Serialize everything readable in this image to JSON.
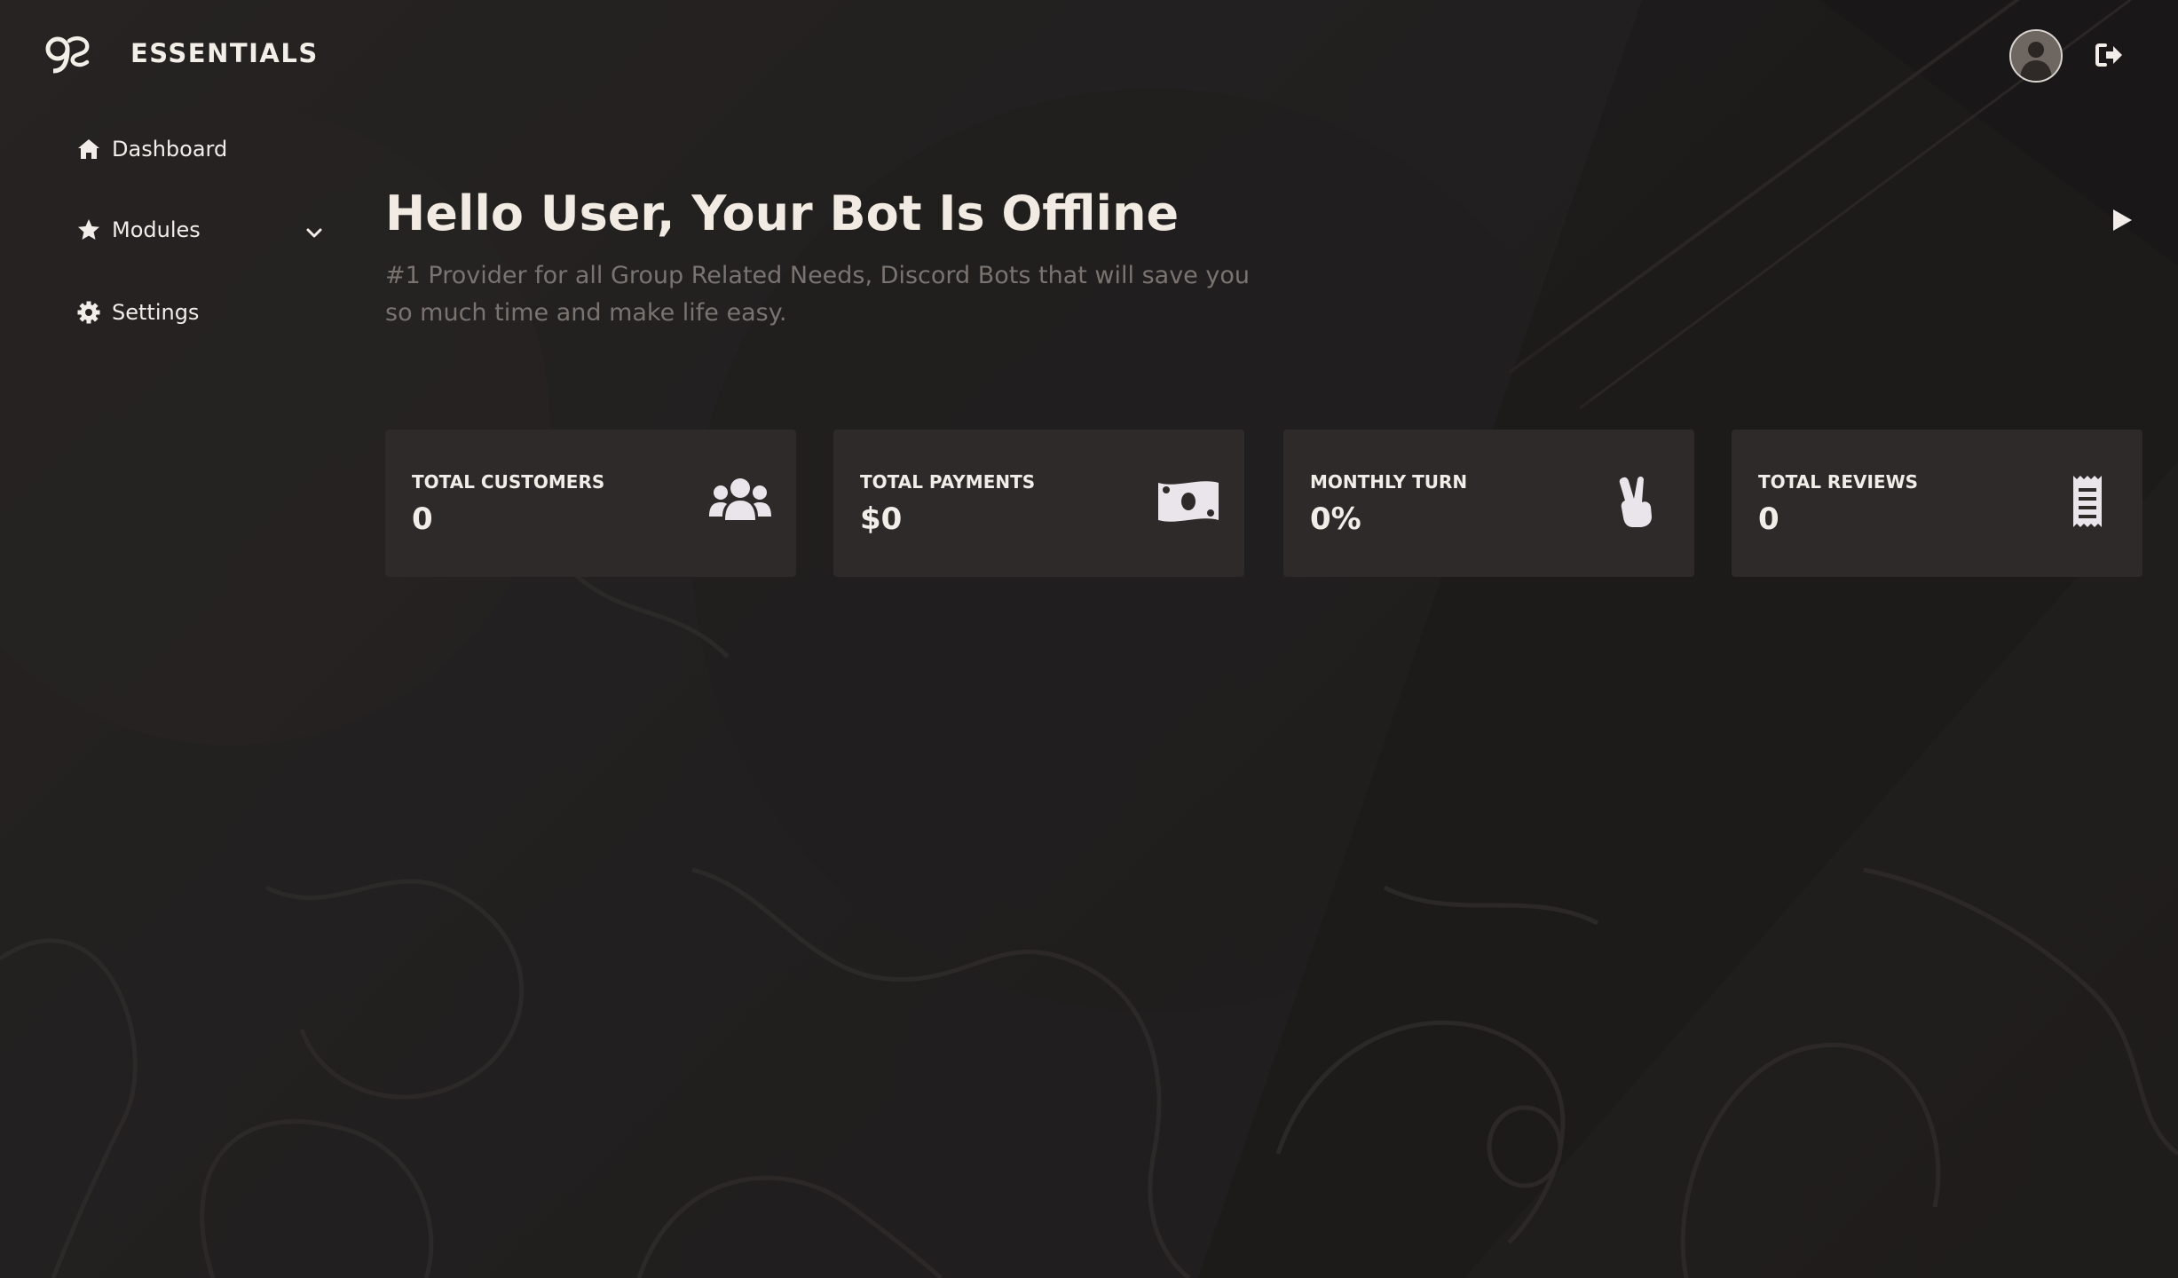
{
  "header": {
    "brand": "ESSENTIALS",
    "logo_icon": "essentials-logo-icon",
    "avatar_icon": "user-avatar",
    "logout_icon": "logout-icon"
  },
  "sidebar": {
    "items": [
      {
        "label": "Dashboard",
        "icon": "home-icon"
      },
      {
        "label": "Modules",
        "icon": "star-icon",
        "chevron": "chevron-down-icon"
      },
      {
        "label": "Settings",
        "icon": "gear-icon"
      }
    ]
  },
  "hero": {
    "title": "Hello User, Your Bot Is Offline",
    "subtitle": "#1 Provider for all Group Related Needs, Discord Bots that will save you so much time and make life easy.",
    "play_icon": "play-icon"
  },
  "stats": [
    {
      "label": "TOTAL CUSTOMERS",
      "value": "0",
      "icon": "users-icon"
    },
    {
      "label": "TOTAL PAYMENTS",
      "value": "$0",
      "icon": "money-bill-icon"
    },
    {
      "label": "MONTHLY TURN",
      "value": "0%",
      "icon": "peace-hand-icon"
    },
    {
      "label": "TOTAL REVIEWS",
      "value": "0",
      "icon": "receipt-icon"
    }
  ],
  "colors": {
    "background": "#211e1e",
    "card": "#2d2a29",
    "text": "#f2ede8",
    "muted_text": "#7a7470"
  }
}
